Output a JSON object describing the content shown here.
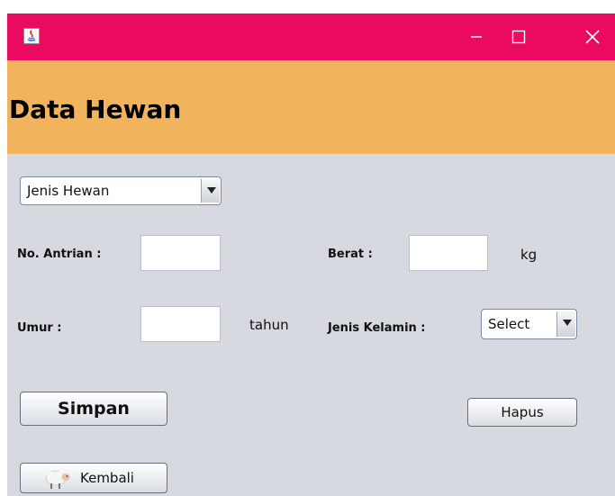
{
  "window": {
    "title": "",
    "controls": [
      "minimize-icon",
      "maximize-icon",
      "close-icon"
    ],
    "titlebar_color": "#ea0a5f"
  },
  "header": {
    "title": "Data Hewan",
    "background": "#f1b35c"
  },
  "form": {
    "animal_type_combo": {
      "selected": "Jenis Hewan"
    },
    "queue_number": {
      "label": "No. Antrian :",
      "value": ""
    },
    "weight": {
      "label": "Berat :",
      "value": "",
      "unit": "kg"
    },
    "age": {
      "label": "Umur :",
      "value": "",
      "unit": "tahun"
    },
    "gender": {
      "label": "Jenis Kelamin :",
      "selected": "Select"
    }
  },
  "buttons": {
    "save": "Simpan",
    "delete": "Hapus",
    "back": "Kembali",
    "back_icon": "sheep-icon"
  }
}
